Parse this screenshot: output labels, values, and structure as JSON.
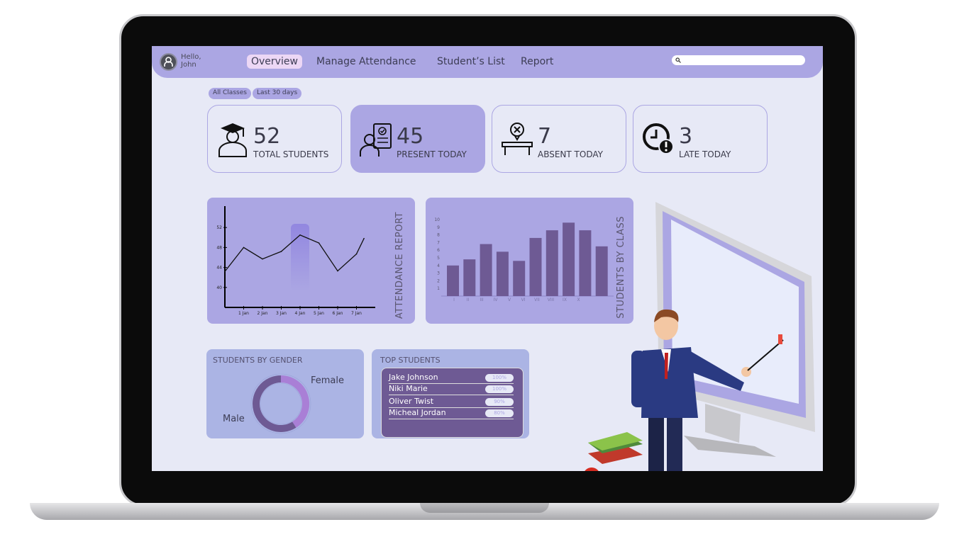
{
  "header": {
    "greeting": "Hello,",
    "user": "John",
    "nav": [
      {
        "label": "Overview",
        "active": true
      },
      {
        "label": "Manage Attendance"
      },
      {
        "label": "Student’s List"
      },
      {
        "label": "Report"
      }
    ],
    "search_placeholder": ""
  },
  "filters": [
    "All Classes",
    "Last 30 days"
  ],
  "stats": [
    {
      "value": "52",
      "label": "TOTAL STUDENTS",
      "icon": "graduate-icon"
    },
    {
      "value": "45",
      "label": "PRESENT TODAY",
      "icon": "checklist-icon"
    },
    {
      "value": "7",
      "label": "ABSENT TODAY",
      "icon": "absent-desk-icon"
    },
    {
      "value": "3",
      "label": "LATE TODAY",
      "icon": "clock-alert-icon"
    }
  ],
  "colors": {
    "accent": "#aba6e3",
    "dark": "#6e5a94",
    "bg": "#e7e9f6",
    "female": "#a97fd6"
  },
  "chart_data": [
    {
      "type": "line",
      "title": "ATTENDANCE REPORT",
      "categories": [
        "1 Jan",
        "2 Jan",
        "3 Jan",
        "4 Jan",
        "5 Jan",
        "6 Jan",
        "7 Jan"
      ],
      "x": [
        0,
        1,
        2,
        3,
        4,
        5,
        6,
        7,
        7.4
      ],
      "values": [
        43.2,
        48,
        45.7,
        47.2,
        50.5,
        48.9,
        43.3,
        46.7,
        49.8
      ],
      "yticks": [
        40,
        44,
        48,
        52
      ],
      "ylim": [
        36,
        56
      ],
      "highlight": "4 Jan"
    },
    {
      "type": "bar",
      "title": "STUDENTS BY CLASS",
      "categories": [
        "I",
        "II",
        "III",
        "IV",
        "V",
        "VI",
        "VII",
        "VIII",
        "IX",
        "X"
      ],
      "values": [
        4,
        4.8,
        6.8,
        5.8,
        4.6,
        7.6,
        8.6,
        9.6,
        8.6,
        6.5
      ],
      "yticks": [
        1,
        2,
        3,
        4,
        5,
        6,
        7,
        8,
        9,
        10
      ],
      "ylim": [
        0,
        10
      ]
    },
    {
      "type": "pie",
      "title": "STUDENTS BY GENDER",
      "series": [
        {
          "name": "Female",
          "value": 41
        },
        {
          "name": "Male",
          "value": 59
        }
      ]
    }
  ],
  "top_students": {
    "title": "TOP STUDENTS",
    "rows": [
      {
        "name": "Jake Johnson",
        "score": "100%"
      },
      {
        "name": "Niki Marie",
        "score": "100%"
      },
      {
        "name": "Oliver Twist",
        "score": "90%"
      },
      {
        "name": "Micheal Jordan",
        "score": "80%"
      }
    ]
  }
}
